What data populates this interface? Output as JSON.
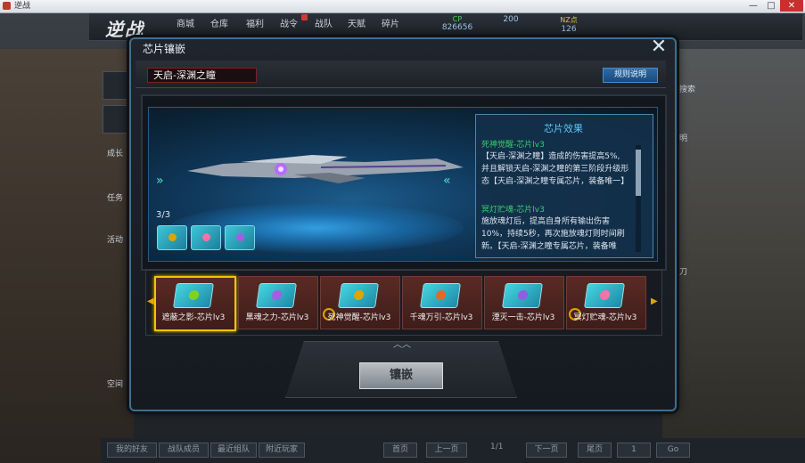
{
  "window": {
    "title": "逆战",
    "min": "—",
    "max": "□",
    "close": "✕"
  },
  "game": {
    "logo": "逆战",
    "nav": [
      "商城",
      "仓库",
      "福利",
      "战令",
      "战队",
      "天赋",
      "碎片"
    ],
    "currency": [
      {
        "label": "CP",
        "value": "826656"
      },
      {
        "label": "",
        "value": "200"
      },
      {
        "label": "NZ点",
        "value": "126"
      }
    ],
    "right_side": [
      "搜索",
      "明",
      "刀"
    ],
    "left_side": [
      "成长",
      "任务",
      "活动",
      "空间"
    ],
    "bottom_tabs": [
      "我的好友",
      "战队成员",
      "最近组队",
      "附近玩家"
    ],
    "pager": {
      "first": "首页",
      "prev": "上一页",
      "page": "1/1",
      "next": "下一页",
      "last": "尾页",
      "input": "1",
      "go": "Go"
    }
  },
  "modal": {
    "title": "芯片镶嵌",
    "close_icon": "✕",
    "weapon_name": "天启-深渊之瞳",
    "rules_button": "规则说明",
    "slot_counter": "3/3",
    "effect": {
      "title": "芯片效果",
      "entries": [
        {
          "name": "死神觉醒-芯片lv3",
          "lines": [
            "【天启-深渊之瞳】造成的伤害提高5%,",
            "并且解锁天启-深渊之瞳的第三阶段升级形",
            "态【天启-深渊之瞳专属芯片，装备唯一】"
          ]
        },
        {
          "name": "冥灯贮魂-芯片lv3",
          "lines": [
            "施放魂灯后，提高自身所有输出伤害",
            "10%，持续5秒，再次施放魂灯则时间刷",
            "新。【天启-深渊之瞳专属芯片，装备唯"
          ]
        }
      ]
    },
    "chips": [
      {
        "label": "遮蔽之影-芯片lv3",
        "selected": true,
        "color": "#7ed321",
        "ring": false
      },
      {
        "label": "黑魂之力-芯片lv3",
        "selected": false,
        "color": "#a45ee5",
        "ring": false
      },
      {
        "label": "死神觉醒-芯片lv3",
        "selected": false,
        "color": "#e0a400",
        "ring": true
      },
      {
        "label": "千魂万引-芯片lv3",
        "selected": false,
        "color": "#e06a2a",
        "ring": false
      },
      {
        "label": "湮灭一击-芯片lv3",
        "selected": false,
        "color": "#8e5fe0",
        "ring": false
      },
      {
        "label": "冥灯贮魂-芯片lv3",
        "selected": false,
        "color": "#ff6fa8",
        "ring": true
      }
    ],
    "inlay_button": "镶嵌",
    "arrows_left": "»",
    "arrows_right": "«",
    "strip_prev": "◀",
    "strip_next": "▶",
    "up_icon": "︿︿"
  },
  "colors": {
    "accent": "#3e6f8f",
    "selected": "#f3c400",
    "effect_name": "#34d06a"
  }
}
